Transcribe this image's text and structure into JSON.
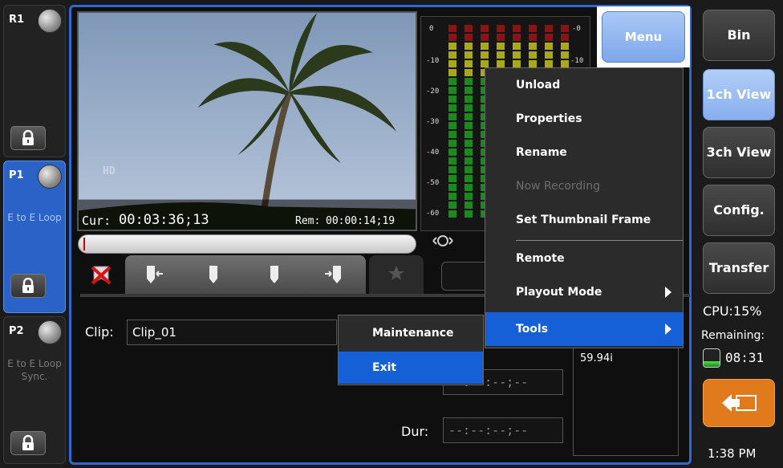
{
  "channels": [
    {
      "label": "R1",
      "mode": ""
    },
    {
      "label": "P1",
      "mode": "E to E Loop"
    },
    {
      "label": "P2",
      "mode": "E to E Loop Sync."
    }
  ],
  "player": {
    "cur_label": "Cur:",
    "cur_time": "00:03:36;13",
    "rem_label": "Rem:",
    "rem_time": "00:00:14;19",
    "hd_badge": "HD"
  },
  "meters": {
    "scale_labels": [
      "0",
      "-10",
      "-20",
      "-30",
      "-40",
      "-50",
      "-60"
    ],
    "right_labels": [
      "-0",
      "-10"
    ]
  },
  "clip": {
    "clip_label": "Clip:",
    "clip_value": "Clip_01",
    "format_value": "59.94i",
    "in_value": "--:--:--;--",
    "dur_label": "Dur:",
    "dur_value": "--:--:--;--"
  },
  "menu_button": "Menu",
  "menu_items": [
    {
      "label": "Unload",
      "disabled": false
    },
    {
      "label": "Properties",
      "disabled": false
    },
    {
      "label": "Rename",
      "disabled": false
    },
    {
      "label": "Now Recording",
      "disabled": true
    },
    {
      "label": "Set Thumbnail Frame",
      "disabled": false
    },
    {
      "label": "Remote",
      "disabled": false
    },
    {
      "label": "Playout Mode",
      "disabled": false,
      "submenu": true
    },
    {
      "label": "Tools",
      "disabled": false,
      "submenu": true,
      "selected": true
    }
  ],
  "tools_submenu": [
    {
      "label": "Maintenance",
      "selected": false
    },
    {
      "label": "Exit",
      "selected": true
    }
  ],
  "sidebar": {
    "bin": "Bin",
    "one_ch": "1ch View",
    "three_ch": "3ch View",
    "config": "Config.",
    "transfer": "Transfer",
    "cpu": "CPU:15%",
    "remaining_label": "Remaining:",
    "remaining_value": "08:31",
    "remaining_level": 0.3,
    "clock": "1:38 PM"
  },
  "colors": {
    "accent": "#2c68d8",
    "selected": "#1560d6",
    "exit_button": "#e07a1c"
  }
}
